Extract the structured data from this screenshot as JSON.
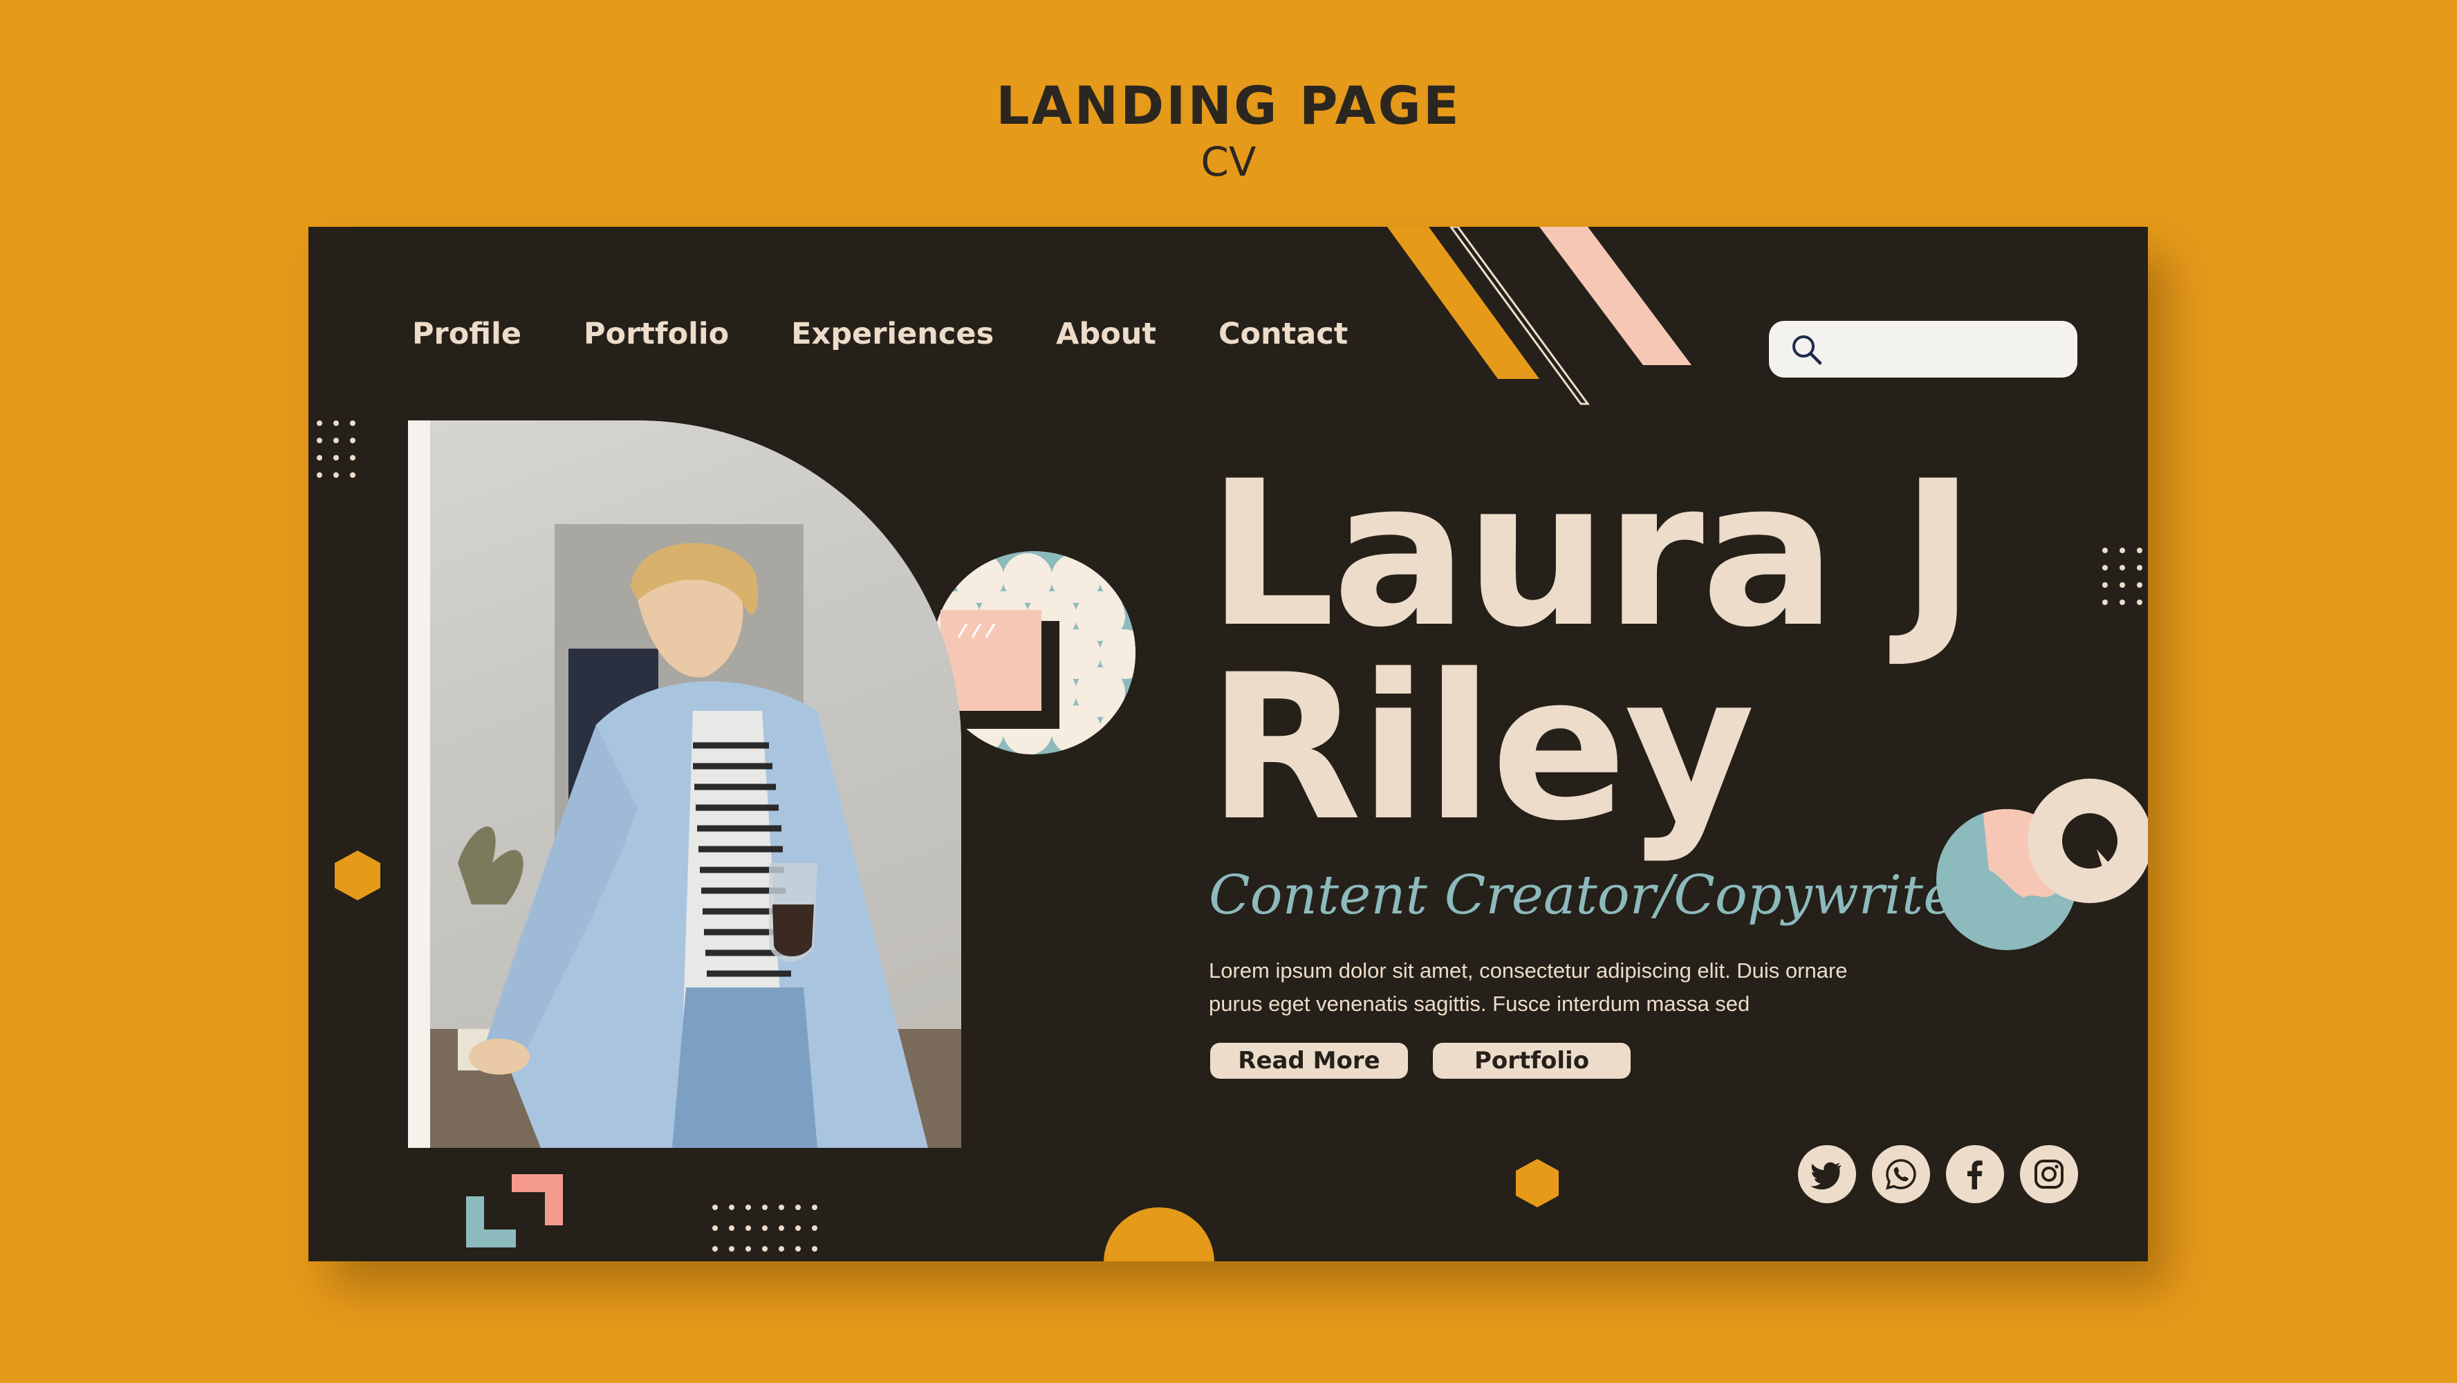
{
  "heading": {
    "title": "LANDING PAGE",
    "subtitle": "CV"
  },
  "nav": {
    "items": [
      {
        "label": "Profile"
      },
      {
        "label": "Portfolio"
      },
      {
        "label": "Experiences"
      },
      {
        "label": "About"
      },
      {
        "label": "Contact"
      }
    ]
  },
  "search": {
    "icon": "search-icon",
    "placeholder": ""
  },
  "hero": {
    "name_line1": "Laura J",
    "name_line2": "Riley",
    "job_title": "Content Creator/Copywriter",
    "description": "Lorem ipsum dolor sit amet, consectetur adipiscing elit. Duis ornare purus eget venenatis sagittis. Fusce interdum massa sed",
    "buttons": {
      "read_more": "Read More",
      "portfolio": "Portfolio"
    }
  },
  "social": [
    {
      "icon": "twitter-icon"
    },
    {
      "icon": "whatsapp-icon"
    },
    {
      "icon": "facebook-icon"
    },
    {
      "icon": "instagram-icon"
    }
  ],
  "colors": {
    "background": "#E69A1A",
    "card": "#252019",
    "cream": "#EDDCC9",
    "teal": "#8CBABD",
    "pink": "#F7C7B6",
    "orange": "#E69A1A"
  }
}
